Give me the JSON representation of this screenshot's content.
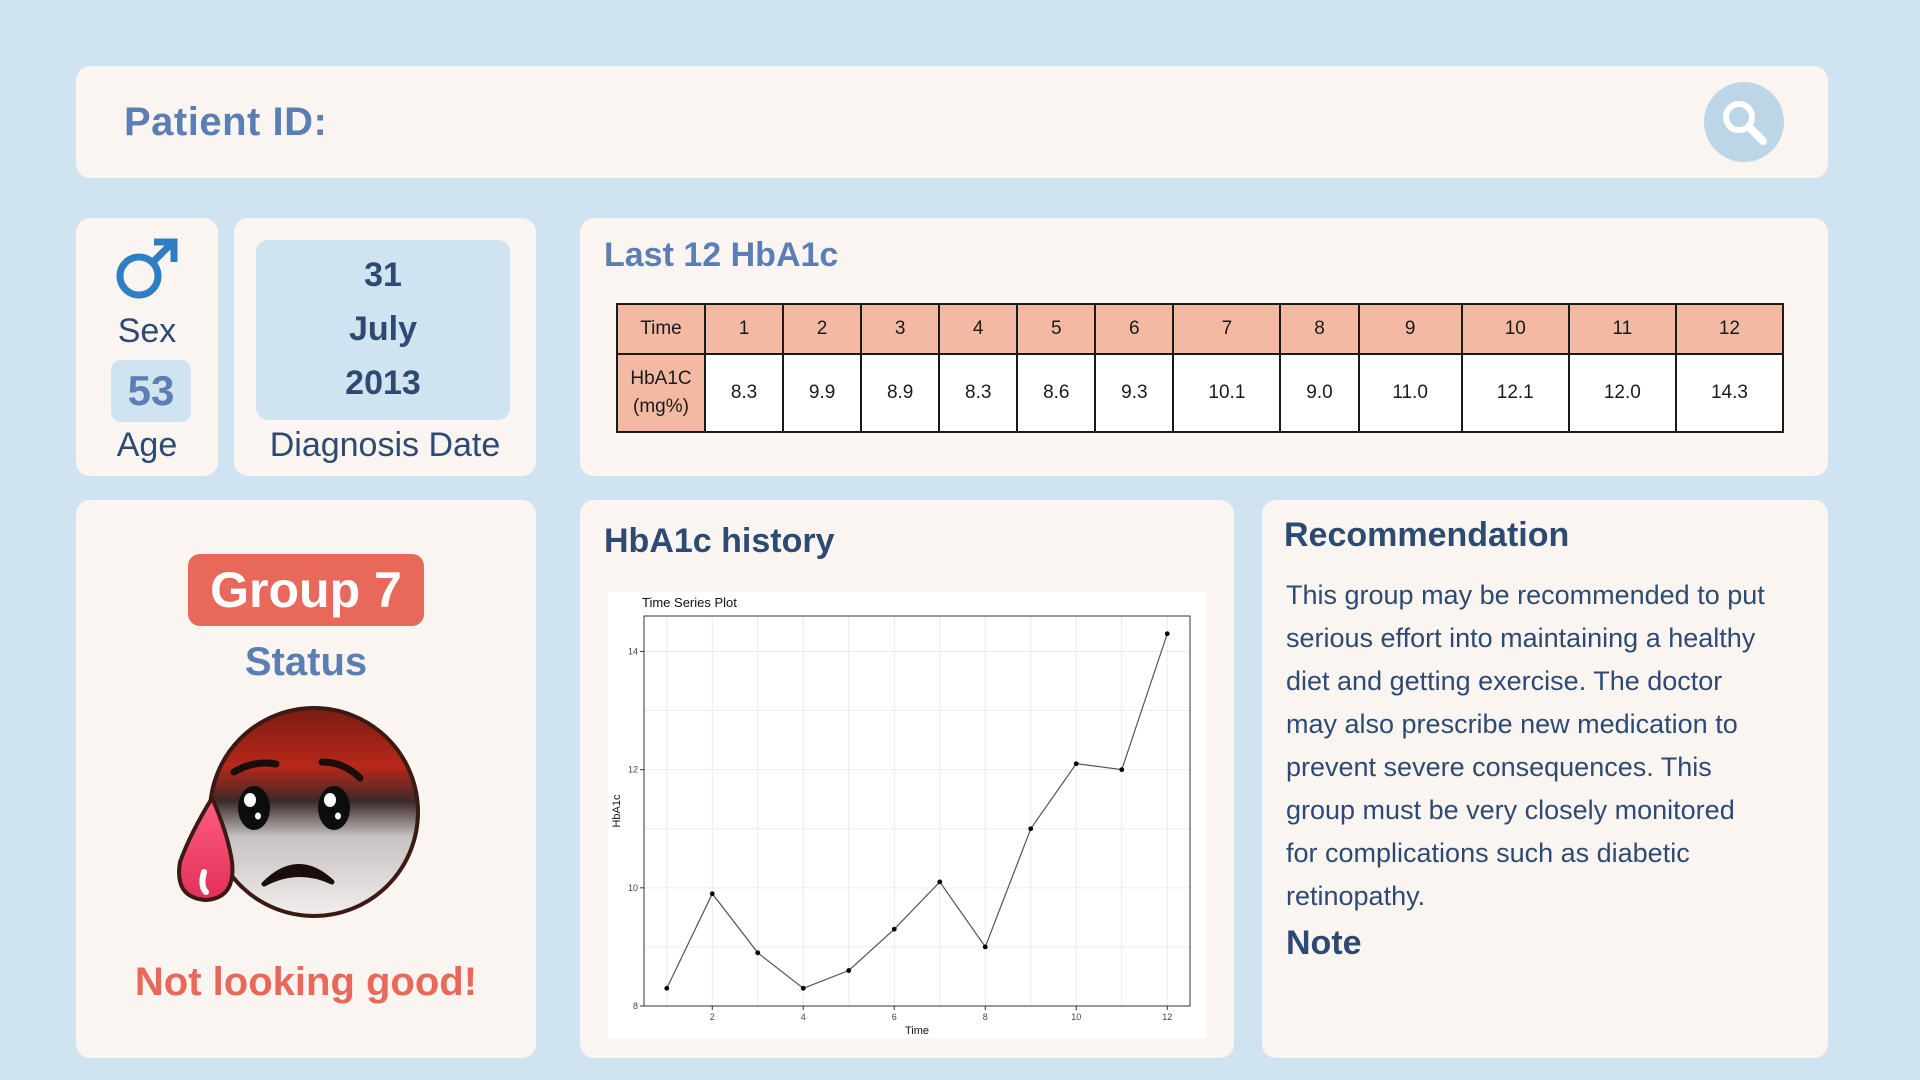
{
  "header": {
    "title": "Patient ID:"
  },
  "icons": {
    "search": "search-icon",
    "sex": "male-icon",
    "status": "anxious-sweat-face-icon"
  },
  "patient": {
    "sex_label": "Sex",
    "age": "53",
    "age_label": "Age",
    "diagnosis_day": "31",
    "diagnosis_month": "July",
    "diagnosis_year": "2013",
    "diagnosis_label": "Diagnosis Date"
  },
  "table": {
    "title": "Last 12 HbA1c",
    "header_label": "Time",
    "row_label_line1": "HbA1C",
    "row_label_line2": "(mg%)",
    "times": [
      "1",
      "2",
      "3",
      "4",
      "5",
      "6",
      "7",
      "8",
      "9",
      "10",
      "11",
      "12"
    ],
    "values": [
      "8.3",
      "9.9",
      "8.9",
      "8.3",
      "8.6",
      "9.3",
      "10.1",
      "9.0",
      "11.0",
      "12.1",
      "12.0",
      "14.3"
    ]
  },
  "status": {
    "group": "Group 7",
    "label": "Status",
    "verdict": "Not looking good!"
  },
  "history": {
    "title": "HbA1c history"
  },
  "chart_data": {
    "type": "line",
    "title": "Time Series Plot",
    "xlabel": "Time",
    "ylabel": "HbA1c",
    "x": [
      1,
      2,
      3,
      4,
      5,
      6,
      7,
      8,
      9,
      10,
      11,
      12
    ],
    "y": [
      8.3,
      9.9,
      8.9,
      8.3,
      8.6,
      9.3,
      10.1,
      9.0,
      11.0,
      12.1,
      12.0,
      14.3
    ],
    "xticks": [
      2,
      4,
      6,
      8,
      10,
      12
    ],
    "yticks": [
      8,
      10,
      12,
      14
    ],
    "xlim": [
      0.5,
      12.5
    ],
    "ylim": [
      8,
      14.6
    ],
    "grid": true,
    "line_color": "#555555",
    "point_color": "#000000"
  },
  "recommendation": {
    "title": "Recommendation",
    "lines": [
      "This group may be recommended to put",
      "serious effort into maintaining a healthy",
      "diet and getting exercise. The doctor",
      "may also prescribe new medication to",
      "prevent severe consequences. This",
      "group must be very closely monitored",
      "for complications such as diabetic",
      "retinopathy."
    ],
    "note_label": "Note"
  },
  "colors": {
    "background": "#cfe3f0",
    "card": "#fbf5f2",
    "accent_blue": "#5b7fb4",
    "dark_blue": "#2d4a72",
    "status_red": "#e8685a",
    "table_header": "#f4b9a2"
  }
}
